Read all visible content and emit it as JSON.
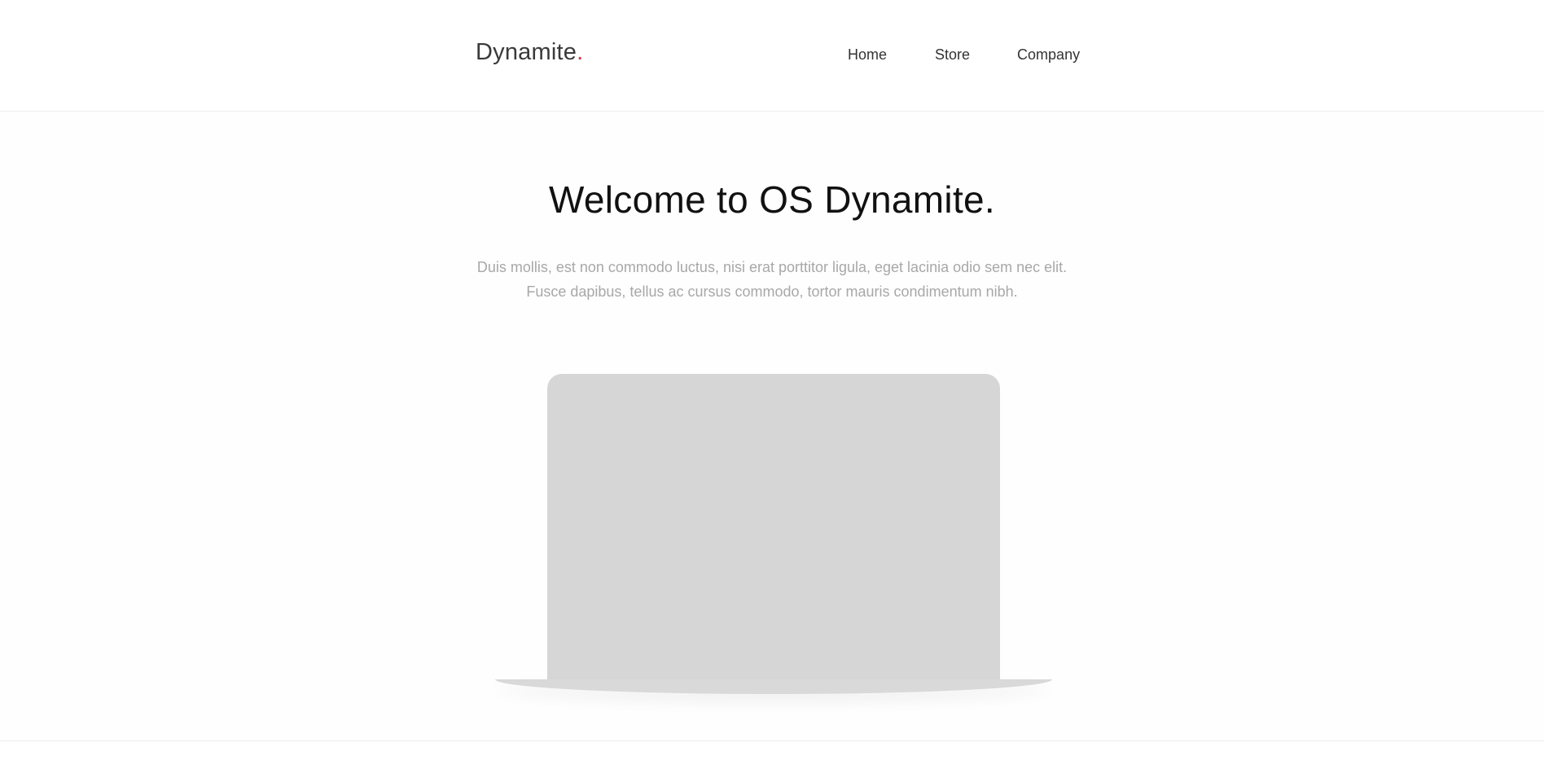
{
  "header": {
    "logo_text": "Dynamite",
    "logo_dot": ".",
    "nav": [
      {
        "label": "Home"
      },
      {
        "label": "Store"
      },
      {
        "label": "Company"
      }
    ]
  },
  "hero": {
    "title": "Welcome to OS Dynamite.",
    "subtitle_line1": "Duis mollis, est non commodo luctus, nisi erat porttitor ligula, eget lacinia odio sem nec elit.",
    "subtitle_line2": "Fusce dapibus, tellus ac cursus commodo, tortor mauris condimentum nibh."
  },
  "colors": {
    "accent_dot": "#e0303d",
    "device_placeholder": "#d6d6d6"
  }
}
